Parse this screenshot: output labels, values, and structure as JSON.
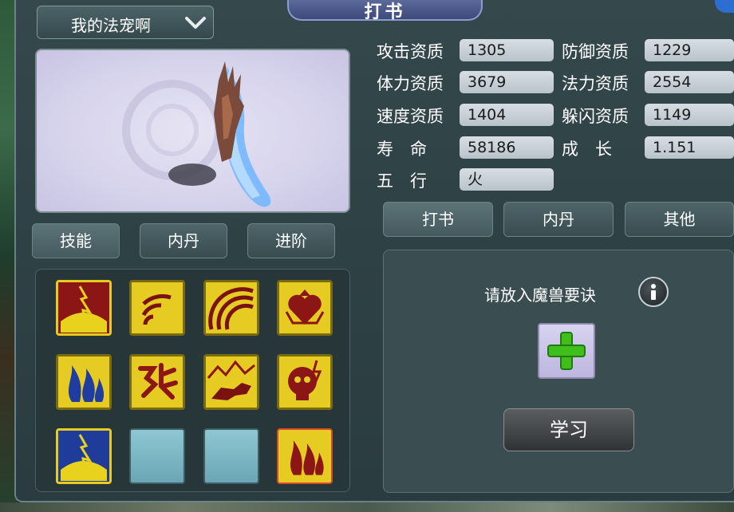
{
  "window": {
    "title": "打书"
  },
  "pet_selector": {
    "label": "我的法宠啊"
  },
  "left_tabs": [
    "技能",
    "内丹",
    "进阶"
  ],
  "stats": [
    {
      "label": "攻击资质",
      "value": "1305"
    },
    {
      "label": "防御资质",
      "value": "1229"
    },
    {
      "label": "体力资质",
      "value": "3679"
    },
    {
      "label": "法力资质",
      "value": "2554"
    },
    {
      "label": "速度资质",
      "value": "1404"
    },
    {
      "label": "躲闪资质",
      "value": "1149"
    },
    {
      "label": "寿　命",
      "value": "58186"
    },
    {
      "label": "成　长",
      "value": "1.151"
    },
    {
      "label": "五　行",
      "value": "火"
    }
  ],
  "right_tabs": [
    "打书",
    "内丹",
    "其他"
  ],
  "learn_panel": {
    "prompt": "请放入魔兽要诀",
    "button": "学习"
  },
  "skills": [
    {
      "icon": "lightning-burst-icon",
      "theme": "red"
    },
    {
      "icon": "sound-wave-icon",
      "theme": "gold"
    },
    {
      "icon": "rainbow-arc-icon",
      "theme": "gold"
    },
    {
      "icon": "heart-shield-icon",
      "theme": "gold"
    },
    {
      "icon": "blue-flame-icon",
      "theme": "gold"
    },
    {
      "icon": "rune-glyph-icon",
      "theme": "gold"
    },
    {
      "icon": "beast-mountain-icon",
      "theme": "gold"
    },
    {
      "icon": "skull-lightning-icon",
      "theme": "gold"
    },
    {
      "icon": "blue-lightning-burst-icon",
      "theme": "blue"
    },
    {
      "icon": "empty-slot",
      "theme": "empty"
    },
    {
      "icon": "empty-slot",
      "theme": "empty"
    },
    {
      "icon": "red-flame-icon",
      "theme": "gold"
    }
  ],
  "colors": {
    "panel": "#2f4246",
    "stat_field": "#c8d0d6",
    "skill_gold": "#e3c81e",
    "skill_dark_red": "#7a1212",
    "add_green": "#41c41f"
  }
}
